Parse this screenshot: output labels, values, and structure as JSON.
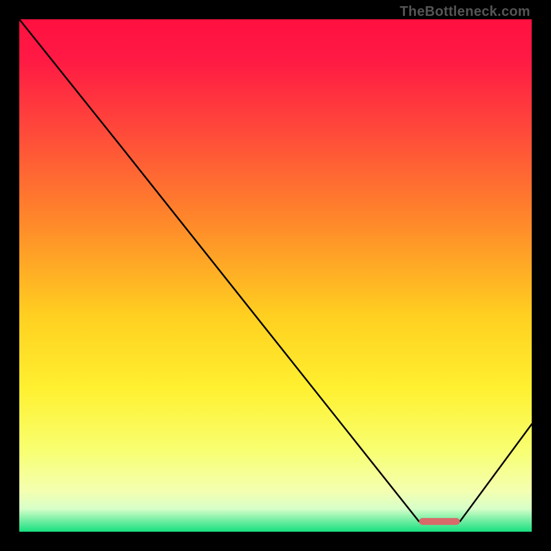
{
  "watermark": "TheBottleneck.com",
  "chart_data": {
    "type": "line",
    "title": "",
    "xlabel": "",
    "ylabel": "",
    "xlim": [
      0,
      100
    ],
    "ylim": [
      0,
      100
    ],
    "x": [
      0,
      20,
      78,
      86,
      100
    ],
    "values": [
      100,
      75,
      2,
      2,
      21
    ],
    "marker_segment": {
      "x_start": 78,
      "x_end": 86,
      "y": 2
    },
    "background_gradient_stops": [
      {
        "pos": 0.0,
        "color": "#ff1040"
      },
      {
        "pos": 0.08,
        "color": "#ff1a44"
      },
      {
        "pos": 0.22,
        "color": "#ff4a3a"
      },
      {
        "pos": 0.4,
        "color": "#ff8a2a"
      },
      {
        "pos": 0.58,
        "color": "#ffd020"
      },
      {
        "pos": 0.72,
        "color": "#fff030"
      },
      {
        "pos": 0.84,
        "color": "#f8ff70"
      },
      {
        "pos": 0.92,
        "color": "#f4ffb0"
      },
      {
        "pos": 0.955,
        "color": "#d8ffc8"
      },
      {
        "pos": 0.975,
        "color": "#80f0a8"
      },
      {
        "pos": 1.0,
        "color": "#18e080"
      }
    ]
  }
}
